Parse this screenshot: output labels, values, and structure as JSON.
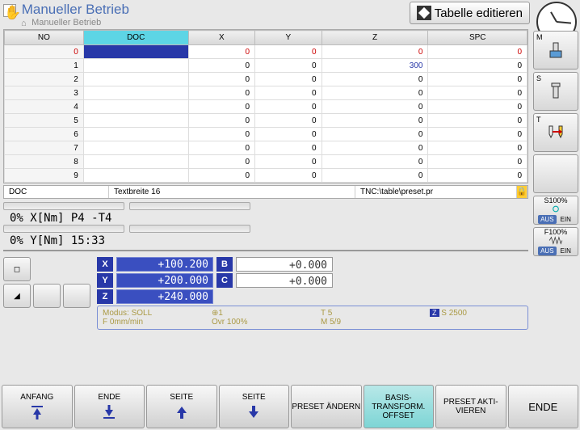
{
  "header": {
    "title": "Manueller Betrieb",
    "subtitle": "Manueller Betrieb",
    "tab_edit": "Tabelle editieren"
  },
  "table": {
    "headers": [
      "NO",
      "DOC",
      "X",
      "Y",
      "Z",
      "SPC"
    ],
    "rows": [
      {
        "no": "0",
        "doc": "",
        "x": "0",
        "y": "0",
        "z": "0",
        "spc": "0"
      },
      {
        "no": "1",
        "doc": "",
        "x": "0",
        "y": "0",
        "z": "300",
        "spc": "0"
      },
      {
        "no": "2",
        "doc": "",
        "x": "0",
        "y": "0",
        "z": "0",
        "spc": "0"
      },
      {
        "no": "3",
        "doc": "",
        "x": "0",
        "y": "0",
        "z": "0",
        "spc": "0"
      },
      {
        "no": "4",
        "doc": "",
        "x": "0",
        "y": "0",
        "z": "0",
        "spc": "0"
      },
      {
        "no": "5",
        "doc": "",
        "x": "0",
        "y": "0",
        "z": "0",
        "spc": "0"
      },
      {
        "no": "6",
        "doc": "",
        "x": "0",
        "y": "0",
        "z": "0",
        "spc": "0"
      },
      {
        "no": "7",
        "doc": "",
        "x": "0",
        "y": "0",
        "z": "0",
        "spc": "0"
      },
      {
        "no": "8",
        "doc": "",
        "x": "0",
        "y": "0",
        "z": "0",
        "spc": "0"
      },
      {
        "no": "9",
        "doc": "",
        "x": "0",
        "y": "0",
        "z": "0",
        "spc": "0"
      }
    ]
  },
  "info": {
    "field1": "DOC",
    "field2": "Textbreite 16",
    "field3": "TNC:\\table\\preset.pr"
  },
  "status": {
    "line1": "0% X[Nm] P4  -T4",
    "line2": "0% Y[Nm] 15:33"
  },
  "dro": {
    "axes": [
      {
        "label": "X",
        "val": "+100.200"
      },
      {
        "label": "Y",
        "val": "+200.000"
      },
      {
        "label": "Z",
        "val": "+240.000"
      }
    ],
    "axes2": [
      {
        "label": "B",
        "val": "+0.000"
      },
      {
        "label": "C",
        "val": "+0.000"
      }
    ]
  },
  "mode": {
    "modus": "Modus: SOLL",
    "icon_val": "1",
    "t": "T 5",
    "s": "S 2500",
    "f": "F 0mm/min",
    "ovr": "Ovr 100%",
    "m": "M 5/9"
  },
  "sidebar": {
    "m": "M",
    "s": "S",
    "t": "T",
    "s100": "S100%",
    "f100": "F100%",
    "aus": "AUS",
    "ein": "EIN"
  },
  "softkeys": {
    "anfang": "ANFANG",
    "ende": "ENDE",
    "seite_up": "SEITE",
    "seite_dn": "SEITE",
    "preset_aendern": "PRESET ÄNDERN",
    "basis": "BASIS-TRANSFORM. OFFSET",
    "preset_akt": "PRESET AKTI-VIEREN",
    "ende2": "ENDE"
  }
}
